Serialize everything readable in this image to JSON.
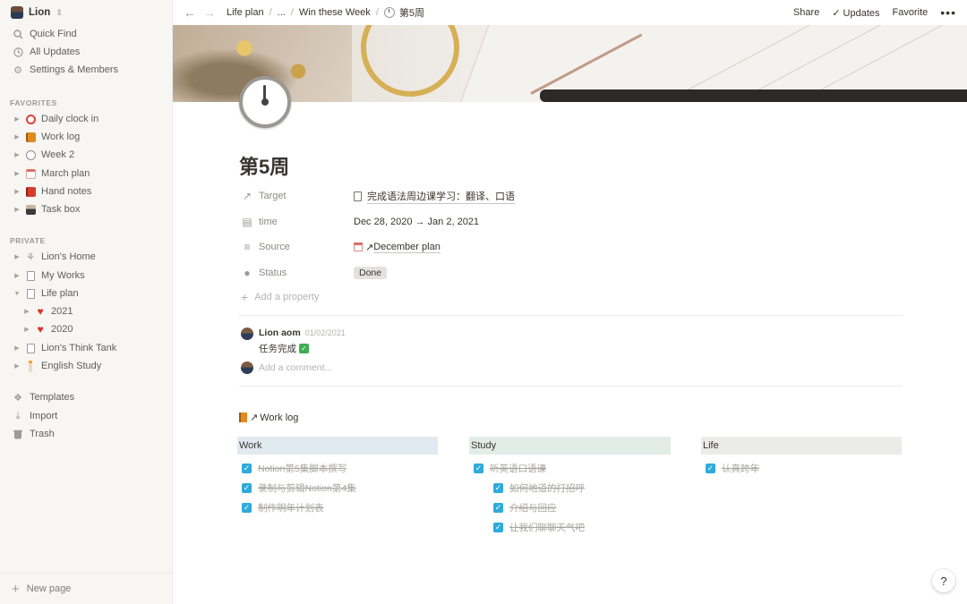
{
  "workspace": {
    "name": "Lion"
  },
  "sidebar": {
    "top_items": [
      {
        "label": "Quick Find",
        "icon": "search-icon"
      },
      {
        "label": "All Updates",
        "icon": "clock-icon"
      },
      {
        "label": "Settings & Members",
        "icon": "gear-icon"
      }
    ],
    "favorites_header": "FAVORITES",
    "favorites": [
      {
        "label": "Daily clock in",
        "icon": "alarm-clock-icon"
      },
      {
        "label": "Work log",
        "icon": "orange-book-icon"
      },
      {
        "label": "Week 2",
        "icon": "clock-face-icon"
      },
      {
        "label": "March plan",
        "icon": "calendar-icon"
      },
      {
        "label": "Hand notes",
        "icon": "red-book-icon"
      },
      {
        "label": "Task box",
        "icon": "card-file-box-icon"
      }
    ],
    "private_header": "PRIVATE",
    "private": [
      {
        "label": "Lion's Home",
        "icon": "rocket-icon",
        "expanded": false
      },
      {
        "label": "My Works",
        "icon": "page-icon",
        "expanded": false
      },
      {
        "label": "Life plan",
        "icon": "page-icon",
        "expanded": true
      },
      {
        "label": "2021",
        "icon": "red-heart-icon",
        "child": true
      },
      {
        "label": "2020",
        "icon": "red-heart-icon",
        "child": true
      },
      {
        "label": "Lion's Think Tank",
        "icon": "page-icon",
        "expanded": false
      },
      {
        "label": "English Study",
        "icon": "candle-icon",
        "expanded": false
      }
    ],
    "bottom_items": [
      {
        "label": "Templates",
        "icon": "templates-icon"
      },
      {
        "label": "Import",
        "icon": "import-icon"
      },
      {
        "label": "Trash",
        "icon": "trash-icon"
      }
    ],
    "new_page": "New page"
  },
  "topbar": {
    "breadcrumbs": [
      "Life plan",
      "...",
      "Win these Week",
      "第5周"
    ],
    "share": "Share",
    "updates": "Updates",
    "favorite": "Favorite",
    "more": "•••"
  },
  "page": {
    "title": "第5周",
    "properties": [
      {
        "name": "Target",
        "icon": "relation-arrow-icon",
        "value": "完成语法周边课学习：翻译、口语"
      },
      {
        "name": "time",
        "icon": "calendar-icon",
        "value": "Dec 28, 2020 → Jan 2, 2021"
      },
      {
        "name": "Source",
        "icon": "text-lines-icon",
        "value": "December plan"
      },
      {
        "name": "Status",
        "icon": "select-icon",
        "value": "Done"
      }
    ],
    "add_property": "Add a property",
    "comment": {
      "author": "Lion aom",
      "timestamp": "01/02/2021",
      "text": "任务完成"
    },
    "add_comment_placeholder": "Add a comment..."
  },
  "work_log": {
    "title": "Work log",
    "columns": [
      {
        "header": "Work",
        "color": "#e1eaf0",
        "items": [
          {
            "text": "Notion第5集脚本撰写",
            "indent": 0
          },
          {
            "text": "录制与剪辑Notion第4集",
            "indent": 0
          },
          {
            "text": "制作明年计划表",
            "indent": 0
          }
        ]
      },
      {
        "header": "Study",
        "color": "#e2ede8",
        "items": [
          {
            "text": "听英语口语课",
            "indent": 0
          },
          {
            "text": "如何地道的打招呼",
            "indent": 1
          },
          {
            "text": "介绍与回应",
            "indent": 1
          },
          {
            "text": "让我们聊聊天气吧",
            "indent": 1
          }
        ]
      },
      {
        "header": "Life",
        "color": "#ebebea",
        "items": [
          {
            "text": "认真跨年",
            "indent": 0
          }
        ]
      }
    ]
  },
  "help": "?"
}
